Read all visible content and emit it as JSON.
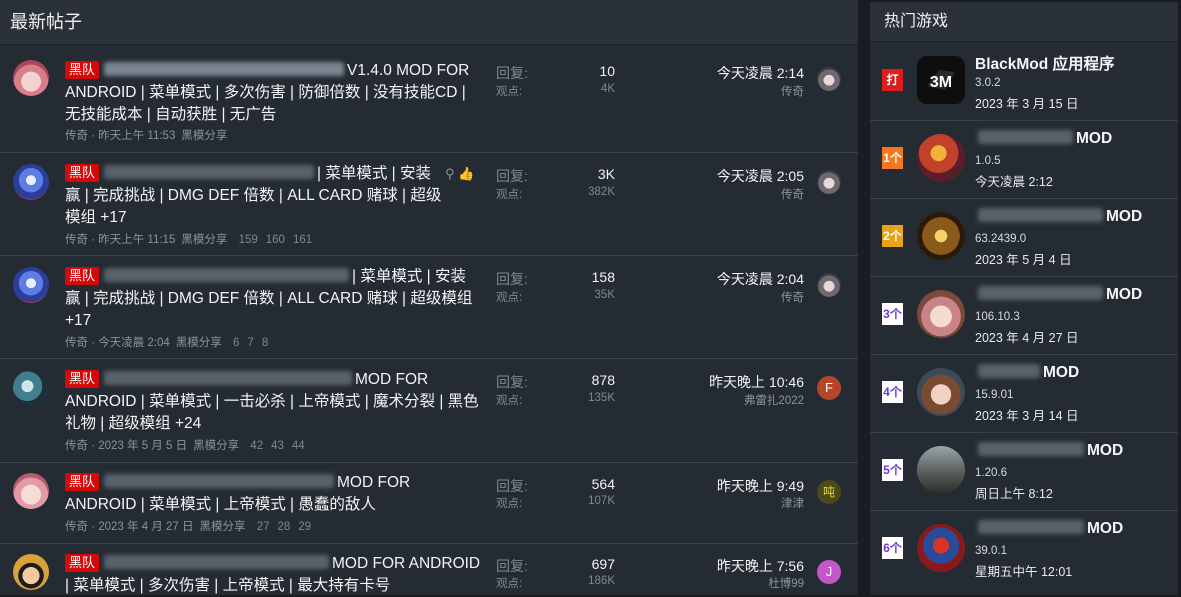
{
  "main": {
    "header": "最新帖子",
    "reply_label": "回复:",
    "views_label": "观点:",
    "threads": [
      {
        "badge": "黑队",
        "title_visible": "V1.4.0 MOD FOR ANDROID | 菜单模式 | 多次伤害 | 防御倍数 | 没有技能CD | 无技能成本 | 自动获胜 | 无广告",
        "author": "传奇",
        "time": "昨天上午 11:53",
        "forum": "黑模分享",
        "pages": [],
        "replies": "10",
        "views": "4K",
        "last_time": "今天凌晨 2:14",
        "last_user": "传奇",
        "last_avatar_char": ""
      },
      {
        "badge": "黑队",
        "title_visible": "| 菜单模式 | 安装赢 | 完成挑战 | DMG DEF 倍数 | ALL CARD 赌球 | 超级模组 +17",
        "author": "传奇",
        "time": "昨天上午 11:15",
        "forum": "黑模分享",
        "pages": [
          "159",
          "160",
          "161"
        ],
        "replies": "3K",
        "views": "382K",
        "last_time": "今天凌晨 2:05",
        "last_user": "传奇",
        "last_avatar_char": ""
      },
      {
        "badge": "黑队",
        "title_visible": "| 菜单模式 | 安装赢 | 完成挑战 | DMG DEF 倍数 | ALL CARD 赌球 | 超级模组 +17",
        "author": "传奇",
        "time": "今天凌晨 2:04",
        "forum": "黑模分享",
        "pages": [
          "6",
          "7",
          "8"
        ],
        "replies": "158",
        "views": "35K",
        "last_time": "今天凌晨 2:04",
        "last_user": "传奇",
        "last_avatar_char": ""
      },
      {
        "badge": "黑队",
        "title_visible": "MOD FOR ANDROID | 菜单模式 | 一击必杀 | 上帝模式 | 魔术分裂 | 黑色礼物 | 超级模组 +24",
        "author": "传奇",
        "time": "2023 年 5 月 5 日",
        "forum": "黑模分享",
        "pages": [
          "42",
          "43",
          "44"
        ],
        "replies": "878",
        "views": "135K",
        "last_time": "昨天晚上 10:46",
        "last_user": "弗雷扎2022",
        "last_avatar_char": "F"
      },
      {
        "badge": "黑队",
        "title_visible": "MOD FOR ANDROID | 菜单模式 | 上帝模式 | 愚蠢的敌人",
        "author": "传奇",
        "time": "2023 年 4 月 27 日",
        "forum": "黑模分享",
        "pages": [
          "27",
          "28",
          "29"
        ],
        "replies": "564",
        "views": "107K",
        "last_time": "昨天晚上 9:49",
        "last_user": "津津",
        "last_avatar_char": "吨"
      },
      {
        "badge": "黑队",
        "title_visible": "MOD FOR ANDROID | 菜单模式 | 多次伤害 | 上帝模式 | 最大持有卡号",
        "author": "",
        "time": "",
        "forum": "",
        "pages": [],
        "replies": "697",
        "views": "186K",
        "last_time": "昨天晚上 7:56",
        "last_user": "杜博99",
        "last_avatar_char": "J"
      }
    ]
  },
  "sidebar": {
    "header": "热门游戏",
    "games": [
      {
        "rank": "打",
        "title": "BlackMod 应用程序",
        "version": "3.0.2",
        "date": "2023 年 3 月 15 日"
      },
      {
        "rank": "1个",
        "title": "MOD",
        "version": "1.0.5",
        "date": "今天凌晨 2:12"
      },
      {
        "rank": "2个",
        "title": "MOD",
        "version": "63.2439.0",
        "date": "2023 年 5 月 4 日"
      },
      {
        "rank": "3个",
        "title": "MOD",
        "version": "106.10.3",
        "date": "2023 年 4 月 27 日"
      },
      {
        "rank": "4个",
        "title": "MOD",
        "version": "15.9.01",
        "date": "2023 年 3 月 14 日"
      },
      {
        "rank": "5个",
        "title": "MOD",
        "version": "1.20.6",
        "date": "周日上午 8:12"
      },
      {
        "rank": "6个",
        "title": "MOD",
        "version": "39.0.1",
        "date": "星期五中午 12:01"
      }
    ]
  },
  "colors": {
    "badge": "#d40a0a",
    "background": "#252b32",
    "header": "#2b3138"
  }
}
